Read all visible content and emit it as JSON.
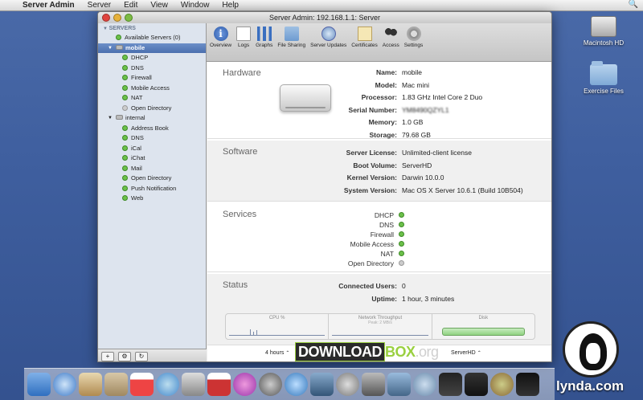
{
  "menubar": {
    "apple": "",
    "items": [
      "Server Admin",
      "Server",
      "Edit",
      "View",
      "Window",
      "Help"
    ],
    "spotlight": "🔍"
  },
  "desktop": {
    "icons": [
      {
        "label": "Macintosh HD"
      },
      {
        "label": "Exercise Files"
      }
    ]
  },
  "window": {
    "title": "Server Admin: 192.168.1.1: Server"
  },
  "sidebar": {
    "heading": "SERVERS",
    "items": [
      {
        "label": "Available Servers (0)",
        "kind": "group"
      },
      {
        "label": "mobile",
        "kind": "server",
        "selected": true
      },
      {
        "label": "DHCP",
        "status": "green"
      },
      {
        "label": "DNS",
        "status": "green"
      },
      {
        "label": "Firewall",
        "status": "green"
      },
      {
        "label": "Mobile Access",
        "status": "green"
      },
      {
        "label": "NAT",
        "status": "green"
      },
      {
        "label": "Open Directory",
        "status": "grey"
      },
      {
        "label": "internal",
        "kind": "server"
      },
      {
        "label": "Address Book",
        "status": "green"
      },
      {
        "label": "DNS",
        "status": "green"
      },
      {
        "label": "iCal",
        "status": "green"
      },
      {
        "label": "iChat",
        "status": "green"
      },
      {
        "label": "Mail",
        "status": "green"
      },
      {
        "label": "Open Directory",
        "status": "green"
      },
      {
        "label": "Push Notification",
        "status": "green"
      },
      {
        "label": "Web",
        "status": "green"
      }
    ],
    "footer_buttons": [
      "+",
      "⚙",
      "↻"
    ]
  },
  "toolbar": {
    "items": [
      {
        "label": "Overview",
        "icon": "overview-icon"
      },
      {
        "label": "Logs",
        "icon": "logs-icon"
      },
      {
        "label": "Graphs",
        "icon": "graphs-icon"
      },
      {
        "label": "File Sharing",
        "icon": "file-sharing-icon"
      },
      {
        "label": "Server Updates",
        "icon": "server-updates-icon"
      },
      {
        "label": "Certificates",
        "icon": "certificates-icon"
      },
      {
        "label": "Access",
        "icon": "access-icon"
      },
      {
        "label": "Settings",
        "icon": "settings-icon"
      }
    ],
    "overview_glyph": "i"
  },
  "hardware": {
    "title": "Hardware",
    "rows": [
      {
        "key": "Name:",
        "value": "mobile"
      },
      {
        "key": "Model:",
        "value": "Mac mini"
      },
      {
        "key": "Processor:",
        "value": "1.83 GHz Intel Core 2 Duo"
      },
      {
        "key": "Serial Number:",
        "value": "YM8490QZYL1"
      },
      {
        "key": "Memory:",
        "value": "1.0 GB"
      },
      {
        "key": "Storage:",
        "value": "79.68 GB"
      }
    ]
  },
  "software": {
    "title": "Software",
    "rows": [
      {
        "key": "Server License:",
        "value": "Unlimited-client license"
      },
      {
        "key": "Boot Volume:",
        "value": "ServerHD"
      },
      {
        "key": "Kernel Version:",
        "value": "Darwin 10.0.0"
      },
      {
        "key": "System Version:",
        "value": "Mac OS X Server 10.6.1 (Build 10B504)"
      }
    ]
  },
  "services": {
    "title": "Services",
    "items": [
      {
        "label": "DHCP",
        "status": "green"
      },
      {
        "label": "DNS",
        "status": "green"
      },
      {
        "label": "Firewall",
        "status": "green"
      },
      {
        "label": "Mobile Access",
        "status": "green"
      },
      {
        "label": "NAT",
        "status": "green"
      },
      {
        "label": "Open Directory",
        "status": "grey"
      }
    ]
  },
  "status": {
    "title": "Status",
    "rows": [
      {
        "key": "Connected Users:",
        "value": "0"
      },
      {
        "key": "Uptime:",
        "value": "1 hour, 3 minutes"
      }
    ],
    "graphs": [
      {
        "label": "CPU %",
        "sub": ""
      },
      {
        "label": "Network Throughput",
        "sub": "Peak: 2 MB/s"
      },
      {
        "label": "Disk",
        "sub": ""
      }
    ],
    "time_range": "4 hours",
    "volume": "ServerHD",
    "popup_glyph": "⌃"
  },
  "watermark": {
    "download": "DOWNLOAD",
    "box": "BOX",
    "org": ".org",
    "lynda": "lynda.com"
  },
  "colors": {
    "status_green": "#6cc04a",
    "selection": "#4a6fae"
  }
}
